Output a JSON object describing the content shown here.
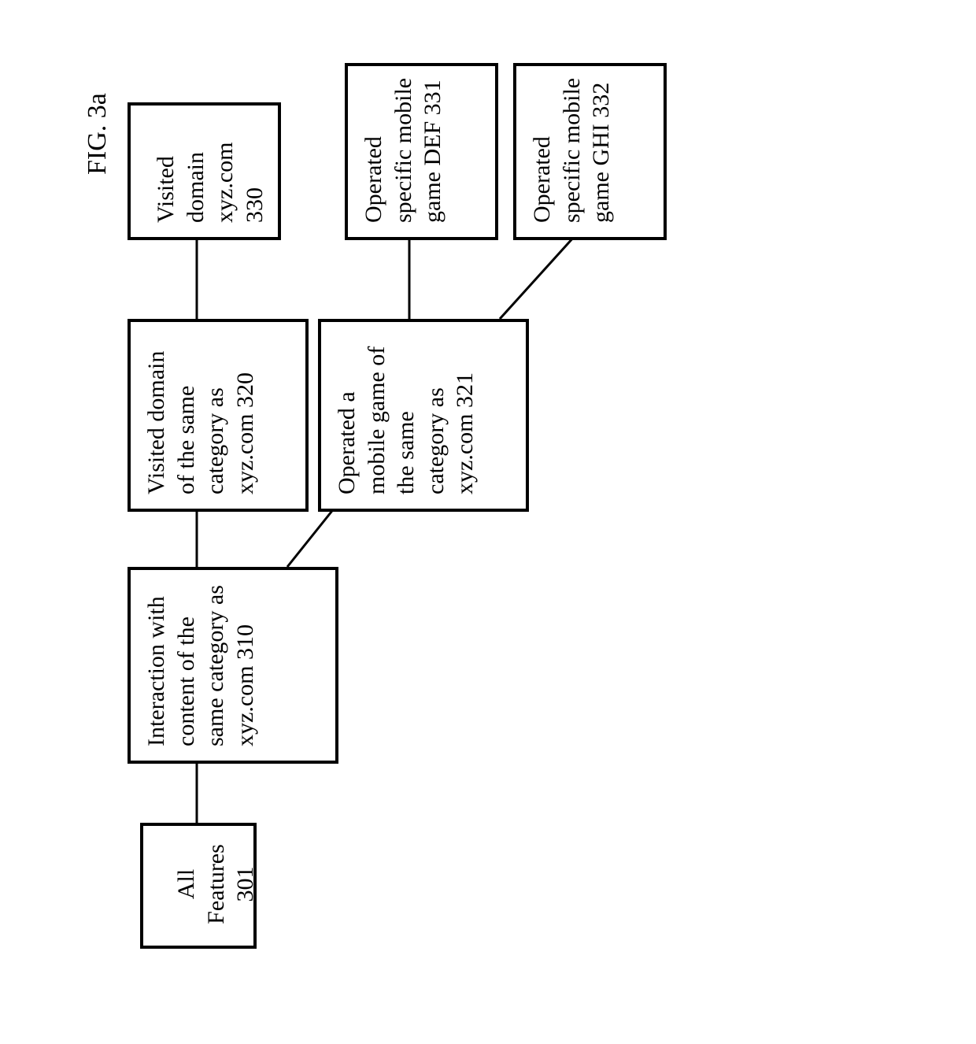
{
  "figure_label": "FIG. 3a",
  "nodes": {
    "n301": {
      "text": "All Features 301"
    },
    "n310": {
      "text": "Interaction with content of the same category as xyz.com 310"
    },
    "n320": {
      "text": "Visited domain of the same category as xyz.com 320"
    },
    "n321": {
      "text": "Operated a mobile game of the same category as xyz.com 321"
    },
    "n330": {
      "text": "Visited domain xyz.com 330"
    },
    "n331": {
      "text": "Operated specific mobile game DEF 331"
    },
    "n332": {
      "text": "Operated specific mobile game GHI 332"
    }
  }
}
